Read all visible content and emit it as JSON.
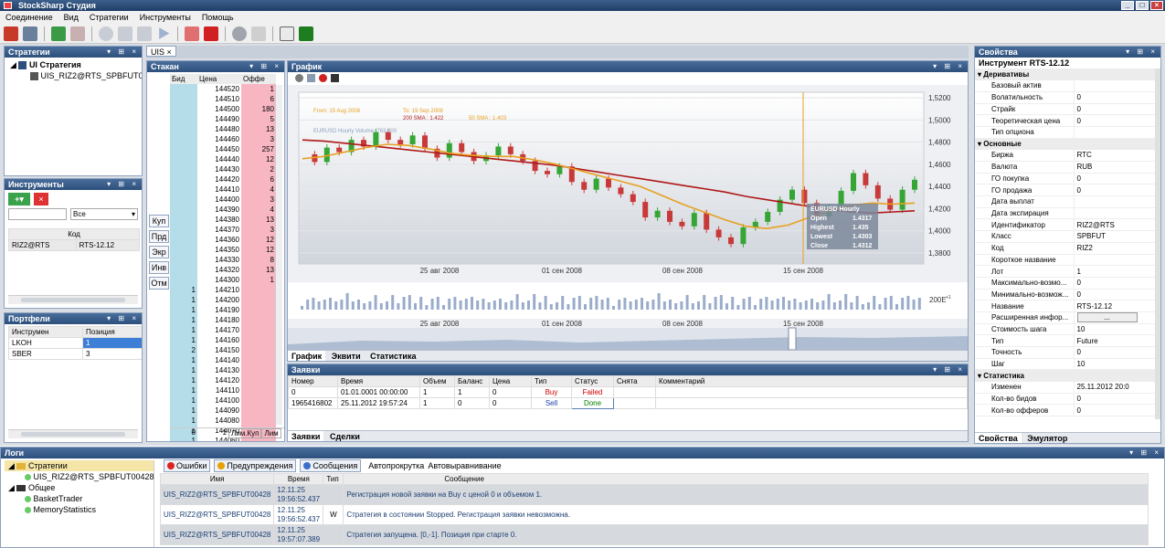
{
  "window": {
    "title": "StockSharp Студия"
  },
  "menu": [
    "Соединение",
    "Вид",
    "Стратегии",
    "Инструменты",
    "Помощь"
  ],
  "panels": {
    "strategies": {
      "title": "Стратегии",
      "root": "UI Стратегия",
      "child": "UIS_RIZ2@RTS_SPBFUT00428"
    },
    "instruments": {
      "title": "Инструменты",
      "filter": "Все",
      "col_code": "Код",
      "rows": [
        {
          "code": "RIZ2@RTS",
          "name": "RTS-12.12"
        }
      ]
    },
    "portfolios": {
      "title": "Портфели",
      "cols": [
        "Инструмен",
        "Позиция"
      ],
      "rows": [
        {
          "inst": "LKOH",
          "pos": "1"
        },
        {
          "inst": "SBER",
          "pos": "3"
        }
      ]
    }
  },
  "doc_tab": "UIS",
  "orderbook": {
    "title": "Стакан",
    "cols": [
      "Бид",
      "Цена",
      "Оффе"
    ],
    "asks": [
      [
        "144520",
        "1"
      ],
      [
        "144510",
        "6"
      ],
      [
        "144500",
        "180"
      ],
      [
        "144490",
        "5"
      ],
      [
        "144480",
        "13"
      ],
      [
        "144460",
        "3"
      ],
      [
        "144450",
        "257"
      ],
      [
        "144440",
        "12"
      ],
      [
        "144430",
        "2"
      ],
      [
        "144420",
        "6"
      ],
      [
        "144410",
        "4"
      ],
      [
        "144400",
        "3"
      ],
      [
        "144390",
        "4"
      ],
      [
        "144380",
        "13"
      ],
      [
        "144370",
        "3"
      ],
      [
        "144360",
        "12"
      ],
      [
        "144350",
        "12"
      ],
      [
        "144330",
        "8"
      ],
      [
        "144320",
        "13"
      ],
      [
        "144300",
        "1"
      ]
    ],
    "bids": [
      [
        "1",
        "144210"
      ],
      [
        "1",
        "144200"
      ],
      [
        "1",
        "144190"
      ],
      [
        "1",
        "144180"
      ],
      [
        "1",
        "144170"
      ],
      [
        "1",
        "144160"
      ],
      [
        "2",
        "144150"
      ],
      [
        "1",
        "144140"
      ],
      [
        "1",
        "144130"
      ],
      [
        "1",
        "144120"
      ],
      [
        "1",
        "144110"
      ],
      [
        "1",
        "144100"
      ],
      [
        "1",
        "144090"
      ],
      [
        "1",
        "144080"
      ],
      [
        "1",
        "144070"
      ],
      [
        "1",
        "144060"
      ]
    ],
    "buttons": [
      "Куп",
      "Прд",
      "Экр",
      "Инв",
      "Отм"
    ],
    "footer": {
      "bid_total": "0",
      "ask_total": "1",
      "limit_buy": "Лим.Куп",
      "limit_sell": "Лим"
    }
  },
  "chart_panel": {
    "title": "График",
    "legend": {
      "from": "From:  15 Aug 2008",
      "to": "To:  19 Sep 2008",
      "sma200": "200 SMA :  1.422",
      "sma50": "50 SMA :  1.403",
      "volume": "EURUSD Hourly Volume:  763.000"
    },
    "tooltip": {
      "title": "EURUSD Hourly",
      "rows": [
        [
          "Open",
          "1.4317"
        ],
        [
          "Highest",
          "1.435"
        ],
        [
          "Lowest",
          "1.4303"
        ],
        [
          "Close",
          "1.4312"
        ]
      ]
    },
    "volume_label": "200E",
    "volume_exp": "+1",
    "tabs": [
      "График",
      "Эквити",
      "Статистика"
    ]
  },
  "chart_data": {
    "type": "line",
    "y_ticks": [
      "1,5200",
      "1,5000",
      "1,4800",
      "1,4600",
      "1,4400",
      "1,4200",
      "1,4000",
      "1,3800"
    ],
    "ylim": [
      1.37,
      1.525
    ],
    "x_ticks": [
      "25 авг 2008",
      "01 сен 2008",
      "08 сен 2008",
      "15 сен 2008"
    ],
    "series": [
      {
        "values": [
          1.469,
          1.462,
          1.475,
          1.471,
          1.482,
          1.476,
          1.489,
          1.482,
          1.478,
          1.486,
          1.474,
          1.466,
          1.479,
          1.471,
          1.463,
          1.468,
          1.476,
          1.469,
          1.463,
          1.454,
          1.451,
          1.458,
          1.444,
          1.437,
          1.447,
          1.439,
          1.433,
          1.426,
          1.412,
          1.418,
          1.408,
          1.404,
          1.416,
          1.401,
          1.394,
          1.388,
          1.403,
          1.408,
          1.417,
          1.428,
          1.437,
          1.425,
          1.413,
          1.421,
          1.436,
          1.452,
          1.441,
          1.429,
          1.419,
          1.437,
          1.446
        ]
      },
      {
        "values": [
          1.482,
          1.481,
          1.479,
          1.477,
          1.475,
          1.473,
          1.471,
          1.469,
          1.467,
          1.465,
          1.463,
          1.461,
          1.459,
          1.456,
          1.453,
          1.45,
          1.447,
          1.444,
          1.441,
          1.438,
          1.435,
          1.431,
          1.428,
          1.425,
          1.422,
          1.419,
          1.417,
          1.416,
          1.417,
          1.418
        ]
      },
      {
        "values": [
          1.465,
          1.467,
          1.471,
          1.475,
          1.478,
          1.477,
          1.474,
          1.47,
          1.468,
          1.467,
          1.467,
          1.464,
          1.46,
          1.455,
          1.45,
          1.445,
          1.44,
          1.432,
          1.424,
          1.417,
          1.41,
          1.404,
          1.402,
          1.405,
          1.412,
          1.418,
          1.423,
          1.425,
          1.424,
          1.425
        ]
      }
    ]
  },
  "orders": {
    "title": "Заявки",
    "cols": [
      "Номер",
      "Время",
      "Объем",
      "Баланс",
      "Цена",
      "Тип",
      "Статус",
      "Снята",
      "Комментарий"
    ],
    "rows": [
      {
        "num": "0",
        "time": "01.01.0001 00:00:00",
        "vol": "1",
        "bal": "1",
        "price": "0",
        "type": "Buy",
        "status": "Failed"
      },
      {
        "num": "1965416802",
        "time": "25.11.2012 19:57:24",
        "vol": "1",
        "bal": "0",
        "price": "0",
        "type": "Sell",
        "status": "Done"
      }
    ],
    "tabs": [
      "Заявки",
      "Сделки"
    ]
  },
  "properties": {
    "title": "Свойства",
    "header_label": "Инструмент",
    "header_value": "RTS-12.12",
    "groups": [
      {
        "name": "Деривативы",
        "rows": [
          [
            "Базовый актив",
            ""
          ],
          [
            "Волатильность",
            "0"
          ],
          [
            "Страйк",
            "0"
          ],
          [
            "Теоретическая цена",
            "0"
          ],
          [
            "Тип опциона",
            ""
          ]
        ]
      },
      {
        "name": "Основные",
        "rows": [
          [
            "Биржа",
            "RTC"
          ],
          [
            "Валюта",
            "RUB"
          ],
          [
            "ГО покупка",
            "0"
          ],
          [
            "ГО продажа",
            "0"
          ],
          [
            "Дата выплат",
            ""
          ],
          [
            "Дата экспирация",
            ""
          ],
          [
            "Идентификатор",
            "RIZ2@RTS"
          ],
          [
            "Класс",
            "SPBFUT"
          ],
          [
            "Код",
            "RIZ2"
          ],
          [
            "Короткое название",
            ""
          ],
          [
            "Лот",
            "1"
          ],
          [
            "Максимально-возмо...",
            "0"
          ],
          [
            "Минимально-возмож...",
            "0"
          ],
          [
            "Название",
            "RTS-12.12"
          ],
          [
            "Расширенная инфор...",
            "..."
          ],
          [
            "Стоимость шага",
            "10"
          ],
          [
            "Тип",
            "Future"
          ],
          [
            "Точность",
            "0"
          ],
          [
            "Шаг",
            "10"
          ]
        ]
      },
      {
        "name": "Статистика",
        "rows": [
          [
            "Изменен",
            "25.11.2012 20:0"
          ],
          [
            "Кол-во бидов",
            "0"
          ],
          [
            "Кол-во офферов",
            "0"
          ]
        ]
      }
    ],
    "tabs": [
      "Свойства",
      "Эмулятор"
    ]
  },
  "logs": {
    "title": "Логи",
    "tree": [
      {
        "label": "Стратегии",
        "level": 0
      },
      {
        "label": "UIS_RIZ2@RTS_SPBFUT00428",
        "level": 1
      },
      {
        "label": "Общее",
        "level": 0
      },
      {
        "label": "BasketTrader",
        "level": 1
      },
      {
        "label": "MemoryStatistics",
        "level": 1
      }
    ],
    "filters": [
      "Ошибки",
      "Предупреждения",
      "Сообщения"
    ],
    "options": [
      "Автопрокрутка",
      "Автовыравнивание"
    ],
    "cols": [
      "Имя",
      "Время",
      "Тип",
      "Сообщение"
    ],
    "rows": [
      {
        "name": "UIS_RIZ2@RTS_SPBFUT00428",
        "date": "12.11.25",
        "time": "19:56:52.437",
        "type": "",
        "msg": "Регистрация новой заявки на Buy с ценой 0 и объемом 1."
      },
      {
        "name": "UIS_RIZ2@RTS_SPBFUT00428",
        "date": "12.11.25",
        "time": "19:56:52.437",
        "type": "W",
        "msg": "Стратегия в состоянии Stopped. Регистрация заявки невозможна."
      },
      {
        "name": "UIS_RIZ2@RTS_SPBFUT00428",
        "date": "12.11.25",
        "time": "19:57:07.389",
        "type": "",
        "msg": "Стратегия запущена. [0,-1]. Позиция при старте 0."
      }
    ]
  },
  "colors": {
    "ask": "#f7b6c2",
    "bid": "#b4dde9",
    "candle_up": "#35a535",
    "candle_down": "#c83a3a",
    "sma200": "#b01818",
    "sma50": "#e8a020",
    "failed": "#d00000",
    "done": "#008000"
  }
}
